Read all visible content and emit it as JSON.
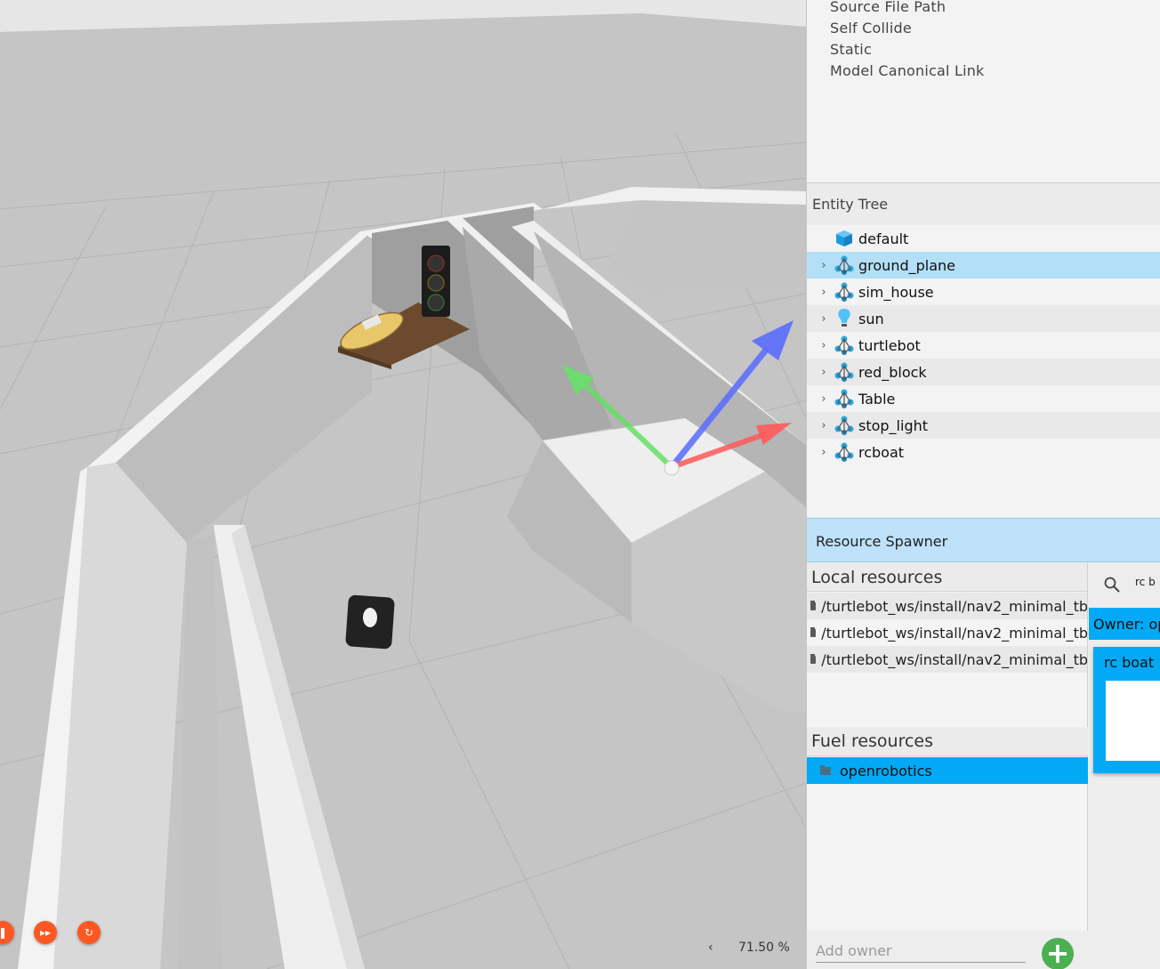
{
  "component_inspector": {
    "properties": [
      "Source File Path",
      "Self Collide",
      "Static",
      "Model Canonical Link"
    ]
  },
  "entity_tree": {
    "title": "Entity Tree",
    "items": [
      {
        "label": "default",
        "icon": "world-cube-icon",
        "expandable": false,
        "selected": false
      },
      {
        "label": "ground_plane",
        "icon": "model-icon",
        "expandable": true,
        "selected": true
      },
      {
        "label": "sim_house",
        "icon": "model-icon",
        "expandable": true,
        "selected": false
      },
      {
        "label": "sun",
        "icon": "light-bulb-icon",
        "expandable": true,
        "selected": false
      },
      {
        "label": "turtlebot",
        "icon": "model-icon",
        "expandable": true,
        "selected": false
      },
      {
        "label": "red_block",
        "icon": "model-icon",
        "expandable": true,
        "selected": false
      },
      {
        "label": "Table",
        "icon": "model-icon",
        "expandable": true,
        "selected": false
      },
      {
        "label": "stop_light",
        "icon": "model-icon",
        "expandable": true,
        "selected": false
      },
      {
        "label": "rcboat",
        "icon": "model-icon",
        "expandable": true,
        "selected": false
      }
    ]
  },
  "resource_spawner": {
    "title": "Resource Spawner",
    "local": {
      "title": "Local resources",
      "paths": [
        "/turtlebot_ws/install/nav2_minimal_tb",
        "/turtlebot_ws/install/nav2_minimal_tb",
        "/turtlebot_ws/install/nav2_minimal_tb"
      ]
    },
    "fuel": {
      "title": "Fuel resources",
      "owners": [
        "openrobotics"
      ]
    },
    "add_owner_placeholder": "Add owner",
    "search_value": "rc b",
    "owner_label": "Owner: op",
    "model_card_name": "rc boat"
  },
  "playback": {
    "play_pause_icon": "pause-icon",
    "step_icon": "fast-forward-icon",
    "reset_icon": "reset-icon",
    "accent": "#ff5722"
  },
  "stats": {
    "rtf_toggle": "‹",
    "real_time_factor": "71.50 %"
  },
  "colors": {
    "selection": "#b3e0f7",
    "fuel_accent": "#03a9f4",
    "add_button": "#4caf50"
  }
}
